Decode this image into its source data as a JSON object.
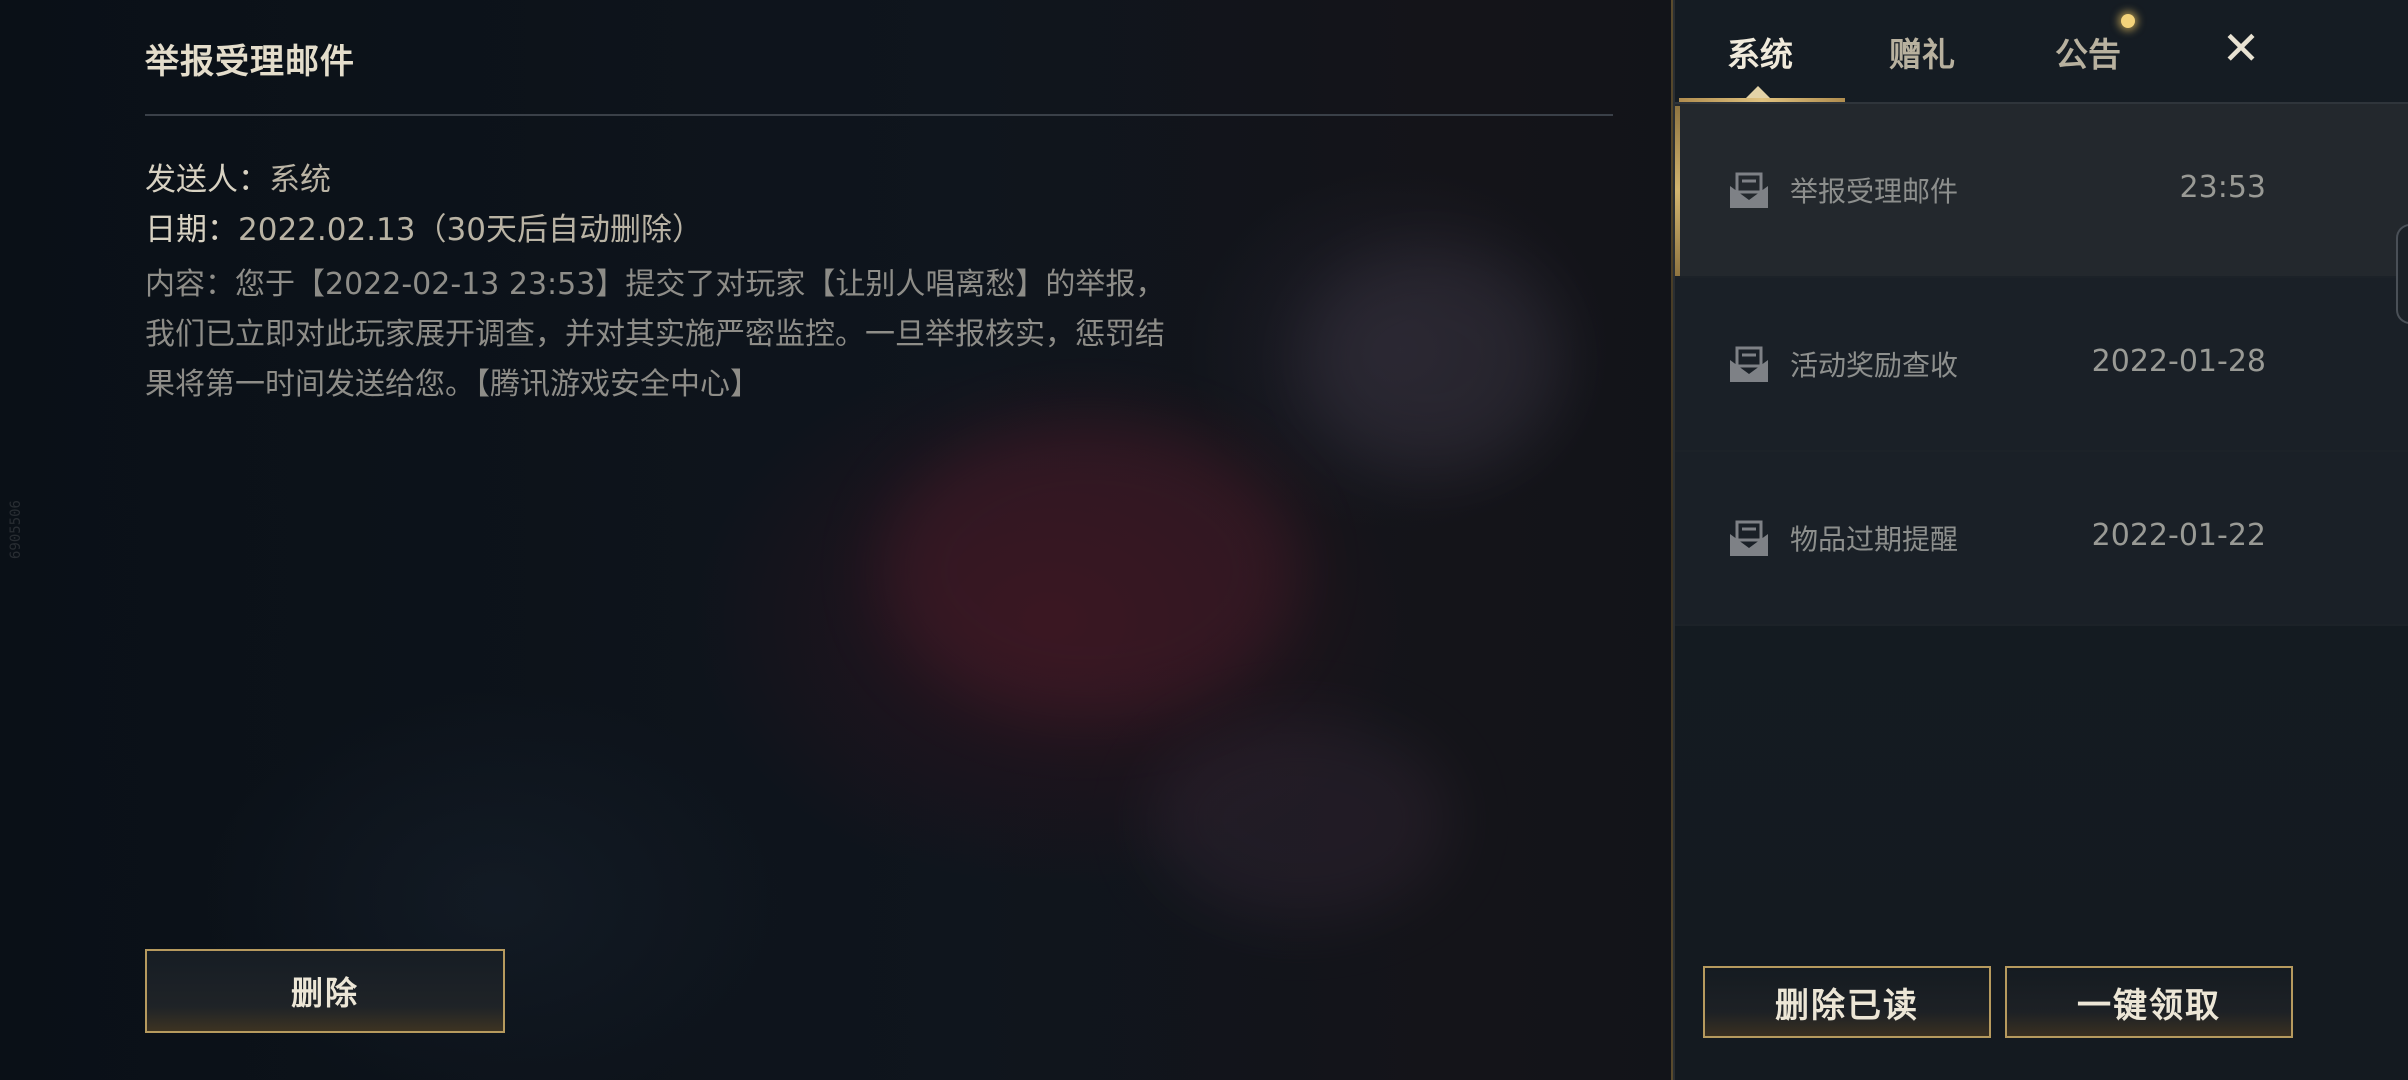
{
  "watermark": "6905506",
  "detail": {
    "title": "举报受理邮件",
    "sender_label": "发送人：",
    "sender_value": "系统",
    "date_label": "日期：",
    "date_value": "2022.02.13（30天后自动删除）",
    "content_lines": [
      "内容：您于【2022-02-13 23:53】提交了对玩家【让别人唱离愁】的举报，",
      "我们已立即对此玩家展开调查，并对其实施严密监控。一旦举报核实，惩罚结",
      "果将第一时间发送给您。【腾讯游戏安全中心】"
    ],
    "delete_label": "删除"
  },
  "tabs": [
    {
      "label": "系统",
      "active": true
    },
    {
      "label": "赠礼",
      "active": false
    },
    {
      "label": "公告",
      "active": false,
      "has_notice_dot": true
    }
  ],
  "close_label": "✕",
  "mails": [
    {
      "subject": "举报受理邮件",
      "date": "23:53",
      "icon": "envelope-icon",
      "selected": true
    },
    {
      "subject": "活动奖励查收",
      "date": "2022-01-28",
      "icon": "envelope-icon",
      "selected": false
    },
    {
      "subject": "物品过期提醒",
      "date": "2022-01-22",
      "icon": "envelope-icon",
      "selected": false
    }
  ],
  "buttons": {
    "delete_read": "删除已读",
    "claim_all": "一键领取"
  },
  "colors": {
    "accent_gold": "#b69a5e",
    "panel_bg": "#151c23",
    "notice_dot": "#f4d37a"
  }
}
